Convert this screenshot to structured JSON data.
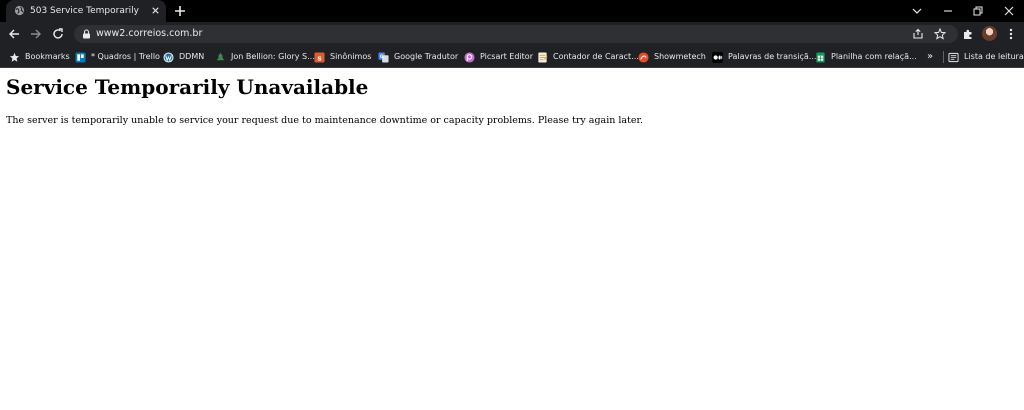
{
  "tab": {
    "title": "503 Service Temporarily Unavailable"
  },
  "address_bar": {
    "url": "www2.correios.com.br"
  },
  "bookmarks_bar": {
    "items": [
      {
        "label": "Bookmarks",
        "icon": "star-icon"
      },
      {
        "label": "* Quadros | Trello",
        "icon": "trello-icon"
      },
      {
        "label": "DDMN",
        "icon": "wordpress-icon"
      },
      {
        "label": "Jon Bellion: Glory S...",
        "icon": "bookmark-favicon"
      },
      {
        "label": "Sinônimos",
        "icon": "sinonimos-icon"
      },
      {
        "label": "Google Tradutor",
        "icon": "google-translate-icon"
      },
      {
        "label": "Picsart Editor",
        "icon": "picsart-icon"
      },
      {
        "label": "Contador de Caract...",
        "icon": "document-icon"
      },
      {
        "label": "Showmetech",
        "icon": "showmetech-icon"
      },
      {
        "label": "Palavras de transiçã...",
        "icon": "medium-icon"
      },
      {
        "label": "Planilha com relaçã...",
        "icon": "sheets-icon"
      }
    ],
    "overflow": "»",
    "reading_list": {
      "label": "Lista de leitura",
      "icon": "reading-list-icon"
    }
  },
  "page": {
    "heading": "Service Temporarily Unavailable",
    "message": "The server is temporarily unable to service your request due to maintenance downtime or capacity problems. Please try again later."
  },
  "colors": {
    "tabstrip": "#000000",
    "toolbar": "#202124",
    "omnibox": "#2f3033",
    "text_light": "#e8eaed"
  }
}
